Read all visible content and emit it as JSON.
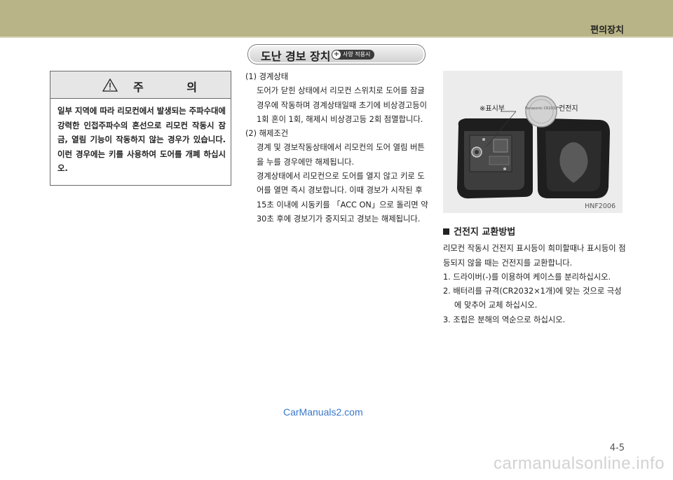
{
  "header": {
    "section": "편의장치"
  },
  "title": {
    "text": "도난 경보 장치",
    "badge": "사양 적용시",
    "badge_icon": "plus"
  },
  "caution": {
    "title": "주  의",
    "body": "일부 지역에 따라 리모컨에서 발생되는 주파수대에 강력한 인접주파수의 혼선으로 리모컨 작동시 잠금, 열림 기능이 작동하지 않는 경우가 있습니다. 이런 경우에는 키를 사용하여 도어를 개폐 하십시오."
  },
  "alarm": {
    "s1_head": "(1) 경계상태",
    "s1_body": "도어가 닫힌 상태에서 리모컨 스위치로 도어를 잠글 경우에 작동하며 경계상태일때 초기에 비상경고등이 1회 혼이 1회, 해제시 비상경고등 2회 점멸합니다.",
    "s2_head": "(2) 해제조건",
    "s2_body1": "경계 및 경보작동상태에서 리모컨의 도어 열림 버튼을 누를 경우에만 해제됩니다.",
    "s2_body2": "경계상태에서 리모컨으로 도어를 열지 않고 키로 도어를 열면 즉시 경보합니다. 이때 경보가 시작된 후 15초 이내에 시동키를 「ACC ON」으로 돌리면 약 30초 후에 경보기가 중지되고 경보는 해제됩니다."
  },
  "figure": {
    "label_mark": "※표시부",
    "label_battery": "건전지",
    "code": "HNF2006",
    "coin_text": "Panasonic CR2032"
  },
  "battery": {
    "heading": "건전지 교환방법",
    "intro": "리모컨 작동시 건전지 표시등이 희미할때나 표시등이 점등되지 않을 때는 건전지를 교환합니다.",
    "steps": [
      "1.  드라이버(-)를 이용하여 케이스를 분리하십시오.",
      "2.  배터리를 규격(CR2032×1개)에 맞는 것으로 극성에 맞추어 교체 하십시오.",
      "3.  조립은 분해의 역순으로 하십시오."
    ]
  },
  "footer": {
    "page": "4-5",
    "watermark": "CarManuals2.com",
    "site": "carmanualsonline.info"
  }
}
